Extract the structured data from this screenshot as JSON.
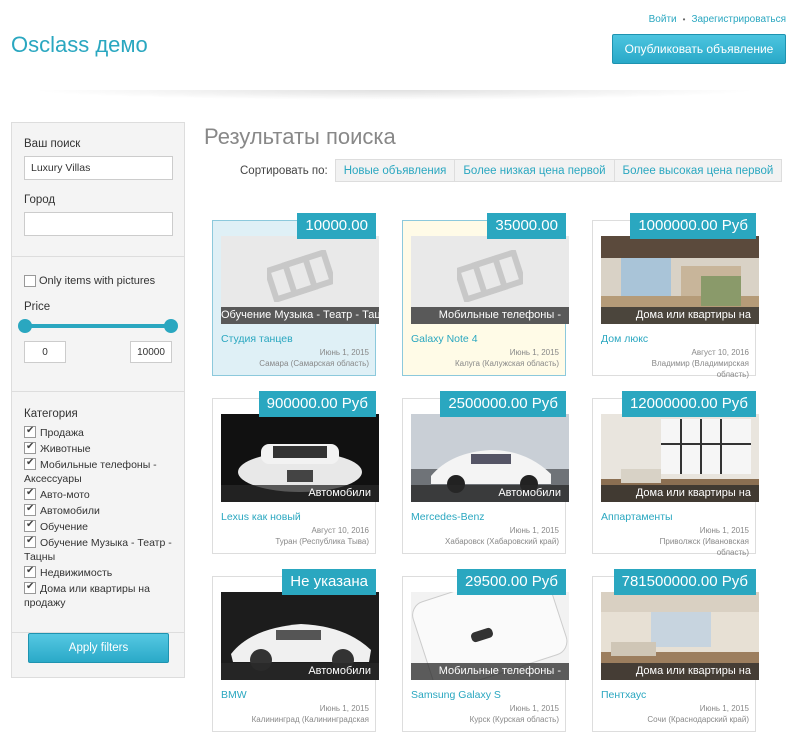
{
  "header": {
    "site_title": "Osclass демо",
    "login": "Войти",
    "register": "Зарегистрироваться",
    "publish": "Опубликовать объявление"
  },
  "sidebar": {
    "search_label": "Ваш поиск",
    "search_value": "Luxury Villas",
    "city_label": "Город",
    "city_value": "",
    "pictures_label": "Only items with pictures",
    "pictures_checked": false,
    "price_label": "Price",
    "price_min": "0",
    "price_max": "10000",
    "category_label": "Категория",
    "categories": [
      "Продажа",
      "Животные",
      "Мобильные телефоны - Аксессуары",
      "Авто-мото",
      "Автомобили",
      "Обучение",
      "Обучение Музыка - Театр - Тацны",
      "Недвижимость",
      "Дома или квартиры на продажу"
    ],
    "apply": "Apply filters"
  },
  "results": {
    "title": "Результаты поиска",
    "sort_label": "Сортировать по:",
    "sort_options": [
      "Новые объявления",
      "Более низкая цена первой",
      "Более высокая цена первой"
    ],
    "items": [
      {
        "price": "10000.00",
        "category": "Обучение Музыка - Театр - Тацны",
        "title": "Студия танцев",
        "date": "Июнь 1, 2015",
        "location": "Самара (Самарская область)",
        "image": "placeholder",
        "highlight": "blue"
      },
      {
        "price": "35000.00",
        "category": "Мобильные телефоны -",
        "title": "Galaxy Note 4",
        "date": "Июнь 1, 2015",
        "location": "Калуга (Калужская область)",
        "image": "placeholder",
        "highlight": "yellow"
      },
      {
        "price": "1000000.00 Руб",
        "category": "Дома или квартиры на",
        "title": "Дом люкс",
        "date": "Август 10, 2016",
        "location": "Владимир (Владимирская область)",
        "image": "house",
        "highlight": ""
      },
      {
        "price": "900000.00 Руб",
        "category": "Автомобили",
        "title": "Lexus как новый",
        "date": "Август 10, 2016",
        "location": "Туран (Республика Тыва)",
        "image": "car-front",
        "highlight": ""
      },
      {
        "price": "2500000.00 Руб",
        "category": "Автомобили",
        "title": "Mercedes-Benz",
        "date": "Июнь 1, 2015",
        "location": "Хабаровск (Хабаровский край)",
        "image": "car-side",
        "highlight": ""
      },
      {
        "price": "12000000.00 Руб",
        "category": "Дома или квартиры на",
        "title": "Аппартаменты",
        "date": "Июнь 1, 2015",
        "location": "Приволжск (Ивановская область)",
        "image": "room",
        "highlight": ""
      },
      {
        "price": "Не указана",
        "category": "Автомобили",
        "title": "BMW",
        "date": "Июнь 1, 2015",
        "location": "Калининград (Калининградская",
        "image": "car-white",
        "highlight": ""
      },
      {
        "price": "29500.00 Руб",
        "category": "Мобильные телефоны -",
        "title": "Samsung Galaxy S",
        "date": "Июнь 1, 2015",
        "location": "Курск (Курская область)",
        "image": "phone",
        "highlight": ""
      },
      {
        "price": "781500000.00 Руб",
        "category": "Дома или квартиры на",
        "title": "Пентхаус",
        "date": "Июнь 1, 2015",
        "location": "Сочи (Краснодарский край)",
        "image": "room2",
        "highlight": ""
      }
    ]
  },
  "colors": {
    "accent": "#2aa7c0",
    "title_gray": "#888888"
  }
}
